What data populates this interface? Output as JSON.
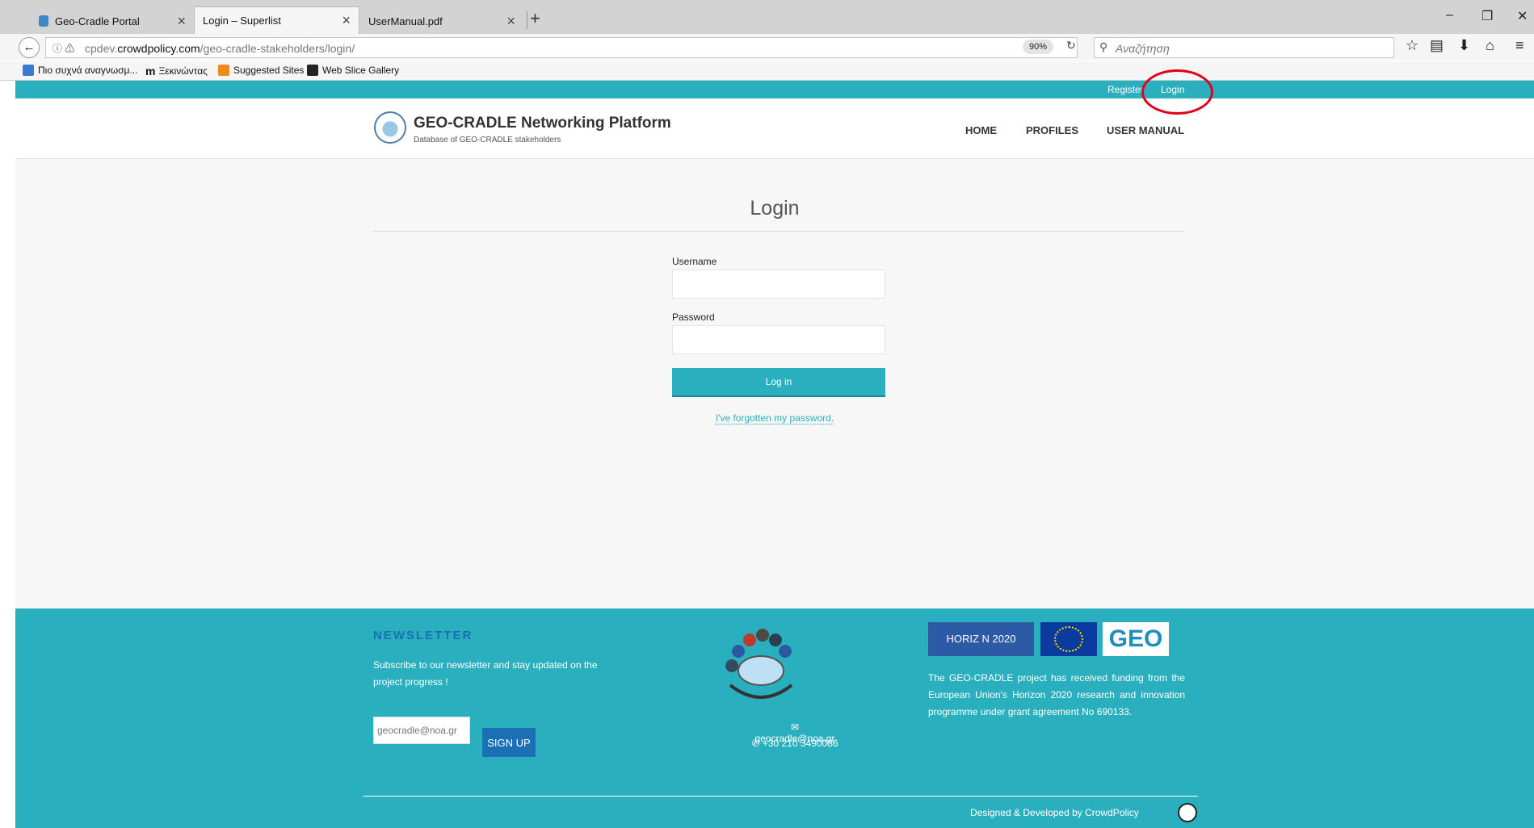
{
  "browser": {
    "tabs": [
      {
        "label": "Geo-Cradle Portal",
        "active": false
      },
      {
        "label": "Login – Superlist",
        "active": true
      },
      {
        "label": "UserManual.pdf",
        "active": false
      }
    ],
    "new_tab": "+",
    "url_prefix": "cpdev.",
    "url_domain": "crowdpolicy.com",
    "url_path": "/geo-cradle-stakeholders/login/",
    "zoom": "90%",
    "search_placeholder": "Αναζήτηση",
    "bookmarks": [
      {
        "label": "Πιο συχνά αναγνωσμ..."
      },
      {
        "label": "Ξεκινώντας"
      },
      {
        "label": "Suggested Sites"
      },
      {
        "label": "Web Slice Gallery"
      }
    ]
  },
  "site": {
    "top_links": {
      "register": "Register",
      "login": "Login"
    },
    "title": "GEO-CRADLE Networking Platform",
    "subtitle": "Database of GEO-CRADLE stakeholders",
    "nav": {
      "home": "HOME",
      "profiles": "PROFILES",
      "manual": "USER MANUAL"
    }
  },
  "login_form": {
    "heading": "Login",
    "username_label": "Username",
    "username_value": "",
    "password_label": "Password",
    "password_value": "",
    "submit": "Log in",
    "forgot": "I've forgotten my password."
  },
  "footer": {
    "newsletter_title": "NEWSLETTER",
    "newsletter_text": "Subscribe to our newsletter and stay updated on the project progress !",
    "newsletter_placeholder": "geocradle@noa.gr",
    "signup": "SIGN UP",
    "email": "geocradle@noa.gr",
    "phone": "+30 210 3490086",
    "horizon_label": "HORIZ  N 2020",
    "geo_label": "GEO",
    "funding_text": "The GEO-CRADLE project has received funding from the European Union's Horizon 2020 research and innovation programme under grant agreement No 690133.",
    "credits": "Designed & Developed by CrowdPolicy"
  },
  "colors": {
    "accent": "#2aafbe",
    "newsletter": "#1a6fb5",
    "annotation": "#e0001b"
  }
}
